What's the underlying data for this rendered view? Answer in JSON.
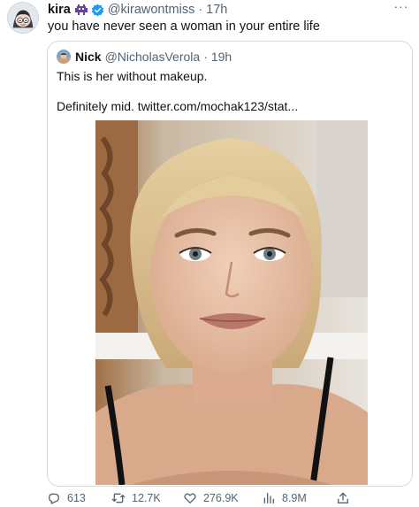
{
  "tweet": {
    "author_name": "kira",
    "author_handle": "@kirawontmiss",
    "separator": "·",
    "time": "17h",
    "text": "you have never seen a woman in your entire life",
    "more_label": "···"
  },
  "quote": {
    "author_name": "Nick",
    "author_handle": "@NicholasVerola",
    "separator": "·",
    "time": "19h",
    "line1": "This is her without makeup.",
    "line2": "Definitely mid.  twitter.com/mochak123/stat..."
  },
  "actions": {
    "replies": "613",
    "retweets": "12.7K",
    "likes": "276.9K",
    "views": "8.9M"
  },
  "colors": {
    "text": "#0f1419",
    "secondary": "#536471",
    "border": "#cfd9de",
    "verified": "#1d9bf0",
    "badge": "#6b3fa0"
  }
}
